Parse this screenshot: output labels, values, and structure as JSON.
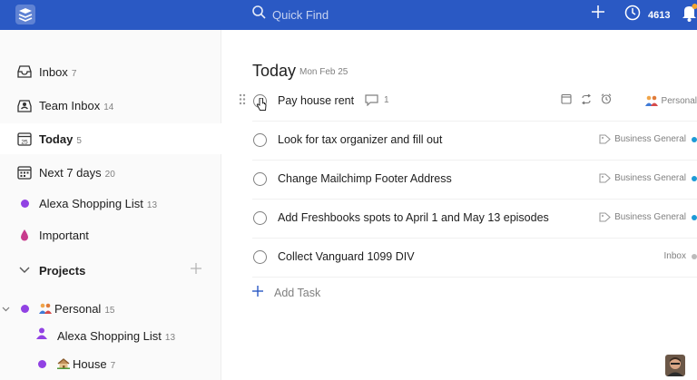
{
  "topbar": {
    "search_placeholder": "Quick Find",
    "karma_count": "4613"
  },
  "sidebar": {
    "items": [
      {
        "label": "Inbox",
        "count": "7"
      },
      {
        "label": "Team Inbox",
        "count": "14"
      },
      {
        "label": "Today",
        "count": "5"
      },
      {
        "label": "Next 7 days",
        "count": "20"
      },
      {
        "label": "Alexa Shopping List",
        "count": "13"
      },
      {
        "label": "Important",
        "count": ""
      }
    ],
    "projects_label": "Projects",
    "projects": [
      {
        "label": "Personal",
        "count": "15"
      },
      {
        "label": "Alexa Shopping List",
        "count": "13"
      },
      {
        "label": "House",
        "count": "7"
      }
    ],
    "today_icon_day": "25"
  },
  "main": {
    "title": "Today",
    "date": "Mon Feb 25",
    "tasks": [
      {
        "title": "Pay house rent",
        "comments": "1",
        "project": "Personal"
      },
      {
        "title": "Look for tax organizer and fill out",
        "project": "Business General"
      },
      {
        "title": "Change Mailchimp Footer Address",
        "project": "Business General"
      },
      {
        "title": "Add Freshbooks spots to April 1 and May 13 episodes",
        "project": "Business General"
      },
      {
        "title": "Collect Vanguard 1099 DIV",
        "project": "Inbox"
      }
    ],
    "add_task_label": "Add Task"
  },
  "colors": {
    "topbar": "#2a59c4",
    "project_dot": "#9142e3",
    "important": "#c83b8d",
    "tag_dot": "#1e9ad6"
  }
}
